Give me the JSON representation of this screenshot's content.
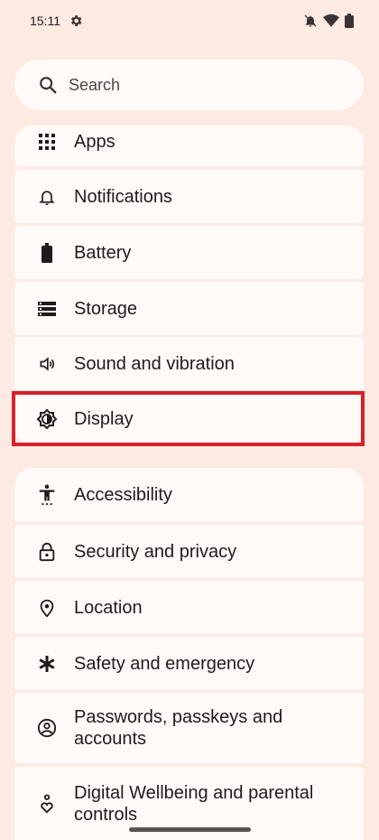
{
  "status_bar": {
    "time": "15:11",
    "icons": [
      "settings-gear-icon",
      "mute-icon",
      "wifi-icon",
      "battery-icon"
    ]
  },
  "search": {
    "placeholder": "Search",
    "icon": "search-icon"
  },
  "groups": [
    {
      "items": [
        {
          "label": "Apps",
          "icon": "apps-grid-icon"
        },
        {
          "label": "Notifications",
          "icon": "bell-icon"
        },
        {
          "label": "Battery",
          "icon": "battery-icon"
        },
        {
          "label": "Storage",
          "icon": "storage-icon"
        },
        {
          "label": "Sound and vibration",
          "icon": "speaker-icon"
        },
        {
          "label": "Display",
          "icon": "brightness-icon",
          "highlighted": true
        }
      ]
    },
    {
      "items": [
        {
          "label": "Accessibility",
          "icon": "accessibility-icon"
        },
        {
          "label": "Security and privacy",
          "icon": "lock-icon"
        },
        {
          "label": "Location",
          "icon": "location-pin-icon"
        },
        {
          "label": "Safety and emergency",
          "icon": "asterisk-icon"
        },
        {
          "label": "Passwords, passkeys and accounts",
          "icon": "account-icon"
        },
        {
          "label": "Digital Wellbeing and parental controls",
          "icon": "wellbeing-icon"
        }
      ]
    }
  ],
  "colors": {
    "background": "#fdeae3",
    "card": "#fffaf8",
    "highlight": "#d9202b"
  }
}
